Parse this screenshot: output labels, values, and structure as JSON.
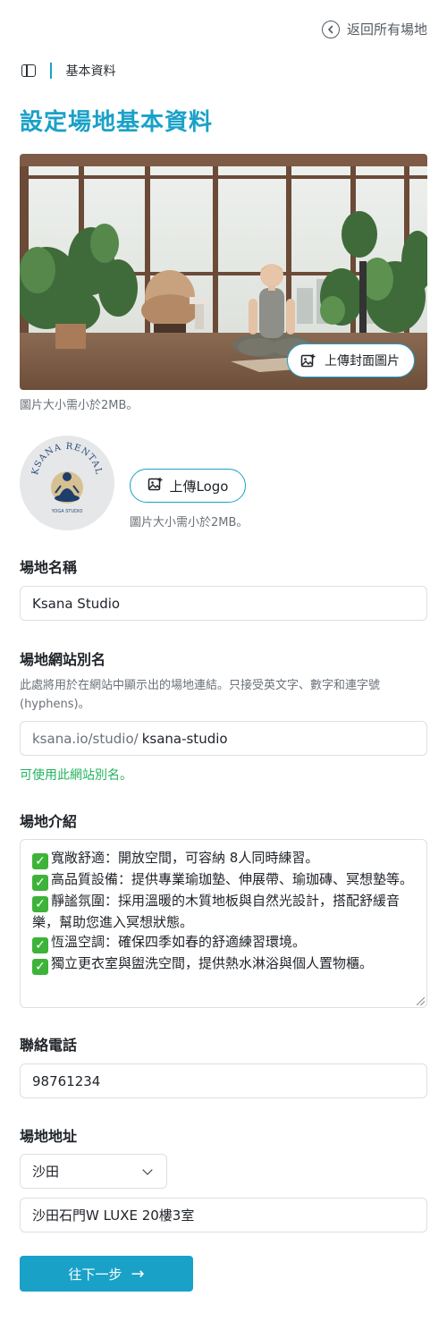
{
  "header": {
    "back_label": "返回所有場地",
    "breadcrumb_label": "基本資料"
  },
  "page_title": "設定場地基本資料",
  "cover": {
    "upload_label": "上傳封面圖片",
    "hint": "圖片大小需小於2MB。"
  },
  "logo": {
    "upload_label": "上傳Logo",
    "hint": "圖片大小需小於2MB。",
    "brand_text": "KSANA RENTAL",
    "brand_sub": "YOGA STUDIO"
  },
  "venue_name": {
    "label": "場地名稱",
    "value": "Ksana Studio"
  },
  "slug": {
    "label": "場地網站別名",
    "description": "此處將用於在網站中顯示出的場地連結。只接受英文字、數字和連字號(hyphens)。",
    "prefix": "ksana.io/studio/",
    "value": "ksana-studio",
    "status": "可使用此網站別名。"
  },
  "intro": {
    "label": "場地介紹",
    "lines": [
      "寬敞舒適：開放空間，可容納 8人同時練習。",
      "高品質設備：提供專業瑜珈墊、伸展帶、瑜珈磚、冥想墊等。",
      "靜謐氛圍：採用溫暖的木質地板與自然光設計，搭配舒緩音樂，幫助您進入冥想狀態。",
      "恆溫空調：確保四季如春的舒適練習環境。",
      "獨立更衣室與盥洗空間，提供熱水淋浴與個人置物櫃。"
    ]
  },
  "phone": {
    "label": "聯絡電話",
    "value": "98761234"
  },
  "address": {
    "label": "場地地址",
    "district": "沙田",
    "value": "沙田石門W LUXE 20樓3室"
  },
  "next_button": {
    "label": "往下一步",
    "arrow": "→"
  },
  "colors": {
    "accent": "#1aa1c8",
    "success": "#22b35e"
  }
}
